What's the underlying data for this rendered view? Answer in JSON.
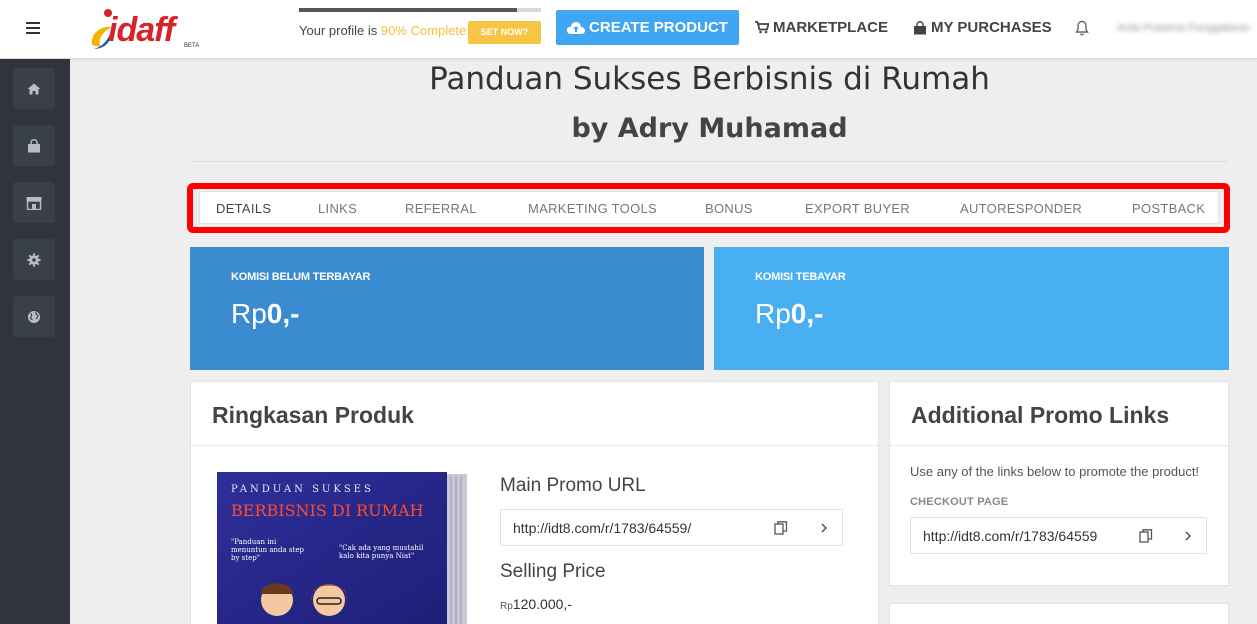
{
  "header": {
    "logo_text": "idaff",
    "logo_beta": "BETA",
    "profile": {
      "text_prefix": "Your profile is ",
      "percent_text": "90% Complete",
      "percent": 90,
      "set_now_label": "SET NOW?"
    },
    "create_product_label": "CREATE PRODUCT",
    "marketplace_label": "MARKETPLACE",
    "my_purchases_label": "MY PURCHASES",
    "username": "Arda Pratama Panggabean"
  },
  "sidebar": {
    "items": [
      {
        "icon": "home-icon"
      },
      {
        "icon": "shopping-bag-icon"
      },
      {
        "icon": "store-icon"
      },
      {
        "icon": "gear-icon"
      },
      {
        "icon": "globe-icon"
      }
    ]
  },
  "page": {
    "title": "Panduan Sukses Berbisnis di Rumah",
    "subtitle": "by Adry Muhamad"
  },
  "tabs": [
    {
      "label": "DETAILS",
      "active": true
    },
    {
      "label": "LINKS",
      "active": false
    },
    {
      "label": "REFERRAL",
      "active": false
    },
    {
      "label": "MARKETING TOOLS",
      "active": false
    },
    {
      "label": "BONUS",
      "active": false
    },
    {
      "label": "EXPORT BUYER",
      "active": false
    },
    {
      "label": "AUTORESPONDER",
      "active": false
    },
    {
      "label": "POSTBACK",
      "active": false
    }
  ],
  "stats": {
    "unpaid": {
      "label": "KOMISI BELUM TERBAYAR",
      "currency": "Rp",
      "value": "0,-"
    },
    "paid": {
      "label": "KOMISI TEBAYAR",
      "currency": "Rp",
      "value": "0,-"
    }
  },
  "summary": {
    "title": "Ringkasan Produk",
    "book": {
      "line1": "PANDUAN SUKSES",
      "line2": "BERBISNIS DI RUMAH",
      "quote1": "\"Panduan ini menuntun anda step by step\"",
      "quote2": "\"Cak ada yang mustahil kalo kita punya Niat\""
    },
    "main_promo_label": "Main Promo URL",
    "main_promo_url": "http://idt8.com/r/1783/64559/",
    "selling_price_label": "Selling Price",
    "price_currency": "Rp",
    "price_value": "120.000,-"
  },
  "promo": {
    "title": "Additional Promo Links",
    "description": "Use any of the links below to promote the product!",
    "checkout_label": "CHECKOUT PAGE",
    "checkout_url": "http://idt8.com/r/1783/64559"
  },
  "colors": {
    "brand_red": "#d8232a",
    "accent_blue": "#3fa6f4",
    "stat_dark_blue": "#3a8bcf",
    "stat_light_blue": "#48aff2",
    "highlight_red": "#ff0000",
    "sidebar_dark": "#2f353b"
  }
}
